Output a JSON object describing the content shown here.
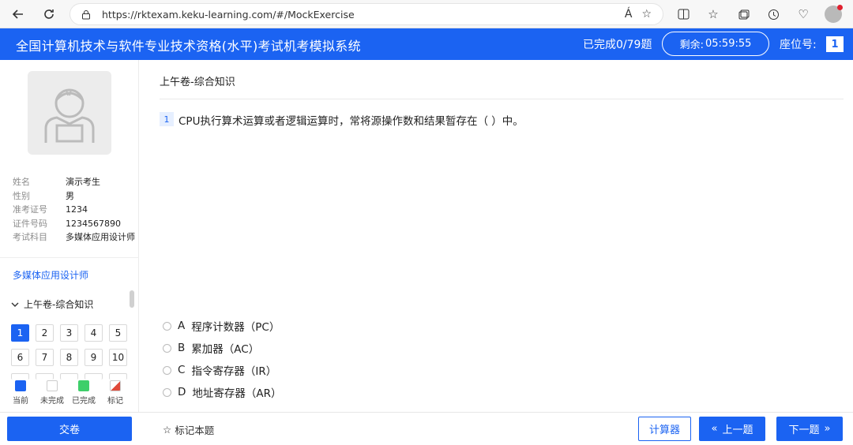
{
  "browser": {
    "url": "https://rktexam.keku-learning.com/#/MockExercise",
    "read_aloud_icon": "Á",
    "icons": [
      "back-icon",
      "refresh-icon",
      "home-icon",
      "lock-icon",
      "read-aloud-icon",
      "favorite-star-icon",
      "split-screen-icon",
      "favorites-icon",
      "collections-icon",
      "history-icon",
      "browser-essentials-icon",
      "profile-avatar-icon"
    ]
  },
  "header": {
    "title": "全国计算机技术与软件专业技术资格(水平)考试机考模拟系统",
    "progress": "已完成0/79题",
    "timer_label": "剩余:",
    "timer_value": "05:59:55",
    "seat_label": "座位号:",
    "seat_number": "1",
    "accent_color": "#1b63f2"
  },
  "candidate": {
    "fields": [
      {
        "label": "姓名",
        "value": "演示考生"
      },
      {
        "label": "性别",
        "value": "男"
      },
      {
        "label": "准考证号",
        "value": "1234"
      },
      {
        "label": "证件号码",
        "value": "1234567890"
      },
      {
        "label": "考试科目",
        "value": "多媒体应用设计师"
      }
    ]
  },
  "sidebar": {
    "subject": "多媒体应用设计师",
    "section": "上午卷-综合知识",
    "questions": [
      "1",
      "2",
      "3",
      "4",
      "5",
      "6",
      "7",
      "8",
      "9",
      "10"
    ],
    "current_question": "1",
    "legend": [
      {
        "label": "当前",
        "kind": "cur"
      },
      {
        "label": "未完成",
        "kind": "todo"
      },
      {
        "label": "已完成",
        "kind": "done"
      },
      {
        "label": "标记",
        "kind": "mark"
      }
    ]
  },
  "main": {
    "section_title": "上午卷-综合知识",
    "question_number": "1",
    "question_text": "CPU执行算术运算或者逻辑运算时，常将源操作数和结果暂存在（ ）中。",
    "options": [
      {
        "letter": "A",
        "text": "程序计数器（PC）"
      },
      {
        "letter": "B",
        "text": "累加器（AC）"
      },
      {
        "letter": "C",
        "text": "指令寄存器（IR）"
      },
      {
        "letter": "D",
        "text": "地址寄存器（AR）"
      }
    ]
  },
  "footer": {
    "submit": "交卷",
    "mark": "标记本题",
    "calculator": "计算器",
    "prev": "上一题",
    "next": "下一题"
  }
}
